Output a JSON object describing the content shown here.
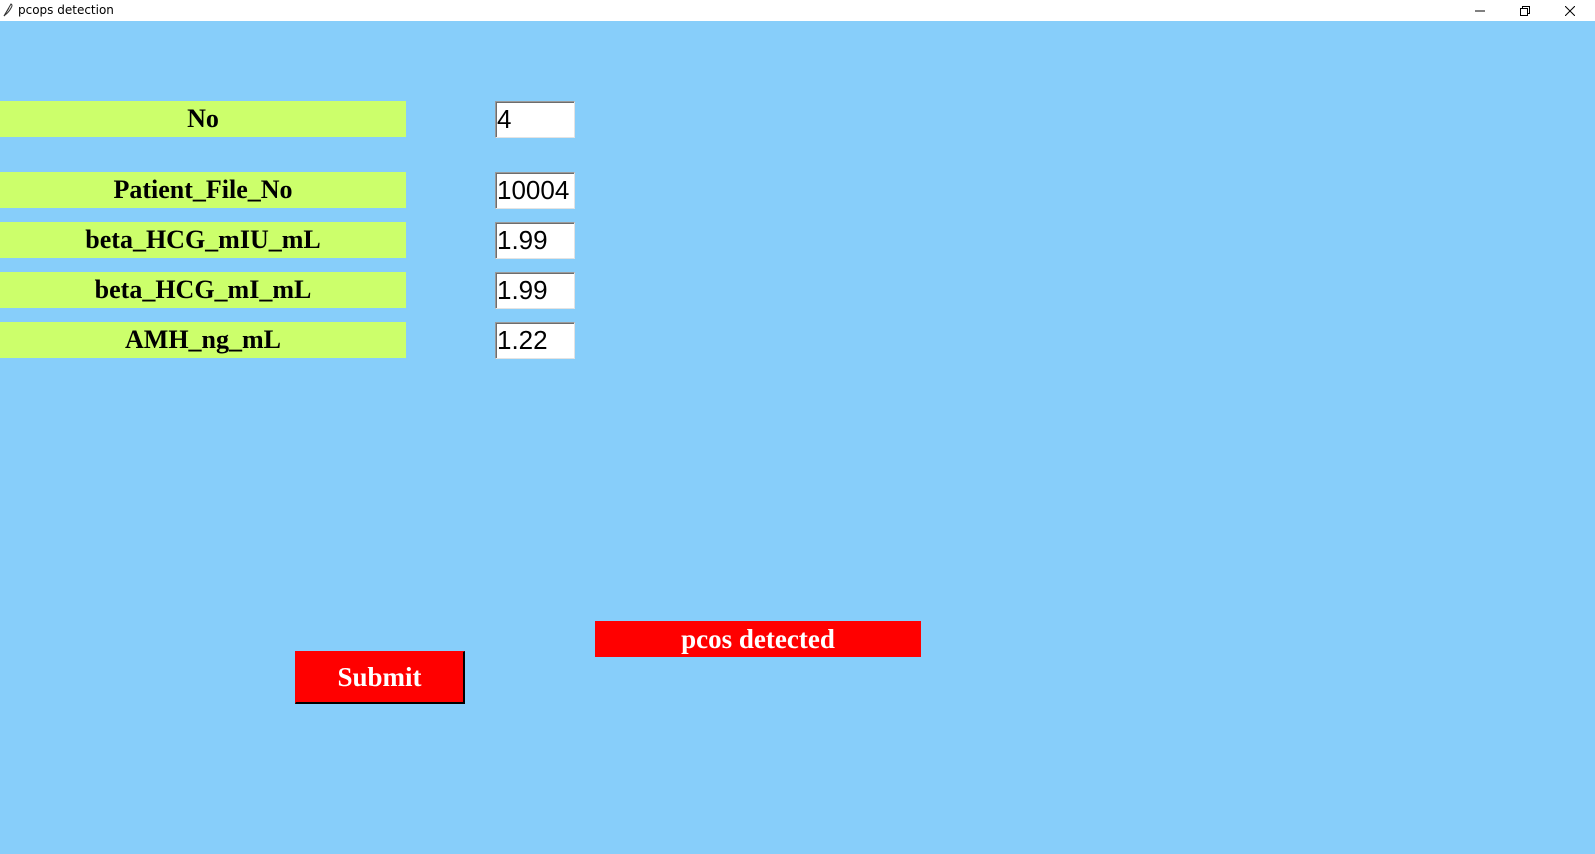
{
  "window": {
    "title": "pcops detection",
    "app_icon": "feather-icon",
    "controls": [
      "minimize-icon",
      "restore-icon",
      "close-icon"
    ]
  },
  "form": {
    "fields": [
      {
        "label": "No",
        "value": "4"
      },
      {
        "label": "Patient_File_No",
        "value": "10004"
      },
      {
        "label": "beta_HCG_mIU_mL",
        "value": "1.99"
      },
      {
        "label": "beta_HCG_mI_mL",
        "value": "1.99"
      },
      {
        "label": "AMH_ng_mL",
        "value": "1.22"
      }
    ],
    "submit_label": "Submit",
    "result_text": "pcos detected"
  },
  "colors": {
    "background": "#87cefa",
    "label_bg": "#ccff6b",
    "button_bg": "#ff0000",
    "result_bg": "#ff0000"
  }
}
